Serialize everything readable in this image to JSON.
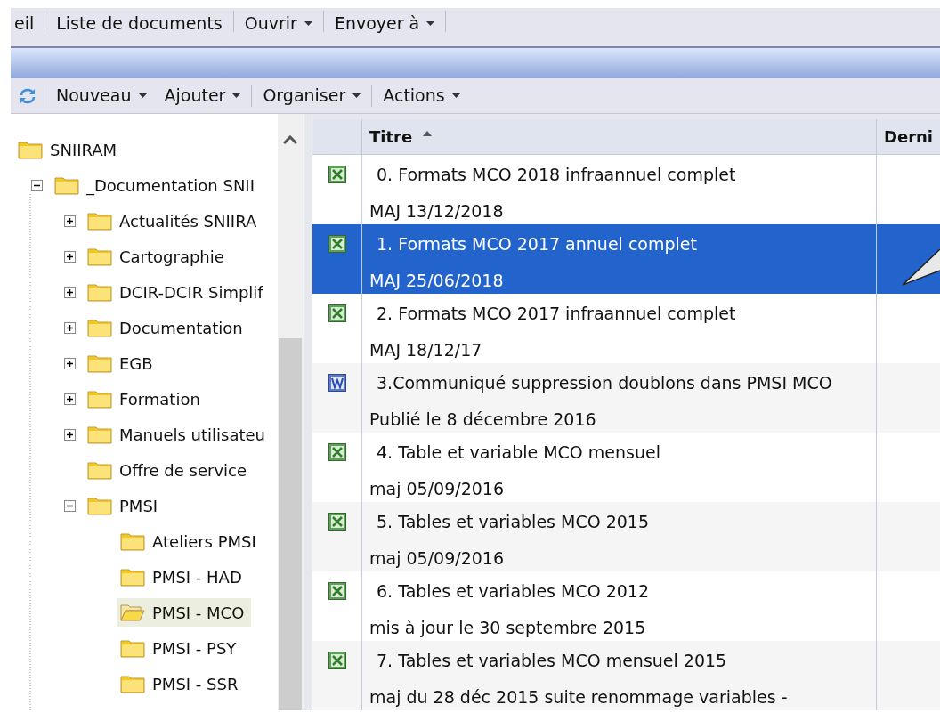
{
  "top_menu": [
    {
      "label": "eil",
      "dropdown": false
    },
    {
      "label": "Liste de documents",
      "dropdown": false
    },
    {
      "label": "Ouvrir",
      "dropdown": true
    },
    {
      "label": "Envoyer à",
      "dropdown": true
    }
  ],
  "toolbar": [
    {
      "label": "Nouveau",
      "dropdown": true,
      "separator_before": true
    },
    {
      "label": "Ajouter",
      "dropdown": true,
      "separator_before": false
    },
    {
      "label": "Organiser",
      "dropdown": true,
      "separator_before": true
    },
    {
      "label": "Actions",
      "dropdown": true,
      "separator_before": true
    }
  ],
  "tree": [
    {
      "label": "SNIIRAM",
      "selected": false,
      "children": [
        {
          "label": "_Documentation SNII",
          "expanded": true,
          "selected": false,
          "children": [
            {
              "label": "Actualités SNIIRA",
              "expanded": false,
              "selected": false
            },
            {
              "label": "Cartographie",
              "expanded": false,
              "selected": false
            },
            {
              "label": "DCIR-DCIR Simplif",
              "expanded": false,
              "selected": false
            },
            {
              "label": "Documentation",
              "expanded": false,
              "selected": false
            },
            {
              "label": "EGB",
              "expanded": false,
              "selected": false
            },
            {
              "label": "Formation",
              "expanded": false,
              "selected": false
            },
            {
              "label": "Manuels utilisateu",
              "expanded": false,
              "selected": false
            },
            {
              "label": "Offre de service",
              "selected": false
            },
            {
              "label": "PMSI",
              "expanded": true,
              "selected": false,
              "children": [
                {
                  "label": "Ateliers PMSI",
                  "selected": false
                },
                {
                  "label": "PMSI - HAD",
                  "selected": false
                },
                {
                  "label": "PMSI - MCO",
                  "selected": true
                },
                {
                  "label": "PMSI - PSY",
                  "selected": false
                },
                {
                  "label": "PMSI - SSR",
                  "selected": false
                }
              ]
            }
          ]
        }
      ]
    }
  ],
  "table": {
    "columns": [
      {
        "label": "Titre",
        "sort_arrow": true
      },
      {
        "label": "Derni",
        "sort_arrow": false
      }
    ],
    "rows": [
      {
        "kind": "excel",
        "title": "0. Formats MCO 2018 infraannuel complet",
        "note": "MAJ 13/12/2018",
        "selected": false
      },
      {
        "kind": "excel",
        "title": "1. Formats MCO 2017 annuel complet",
        "note": "MAJ 25/06/2018",
        "selected": true
      },
      {
        "kind": "excel",
        "title": "2. Formats MCO 2017 infraannuel complet",
        "note": "MAJ 18/12/17",
        "selected": false
      },
      {
        "kind": "word",
        "title": "3.Communiqué suppression doublons dans PMSI MCO",
        "note": "Publié le 8 décembre 2016",
        "selected": false
      },
      {
        "kind": "excel",
        "title": "4. Table et variable MCO mensuel",
        "note": "maj 05/09/2016",
        "selected": false
      },
      {
        "kind": "excel",
        "title": "5. Tables et variables MCO 2015",
        "note": "maj 05/09/2016",
        "selected": false
      },
      {
        "kind": "excel",
        "title": "6. Tables et variables MCO 2012",
        "note": "mis à jour le 30 septembre 2015",
        "selected": false
      },
      {
        "kind": "excel",
        "title": "7. Tables et variables MCO mensuel 2015",
        "note": "maj du 28 déc 2015 suite renommage variables -",
        "selected": false
      }
    ]
  }
}
